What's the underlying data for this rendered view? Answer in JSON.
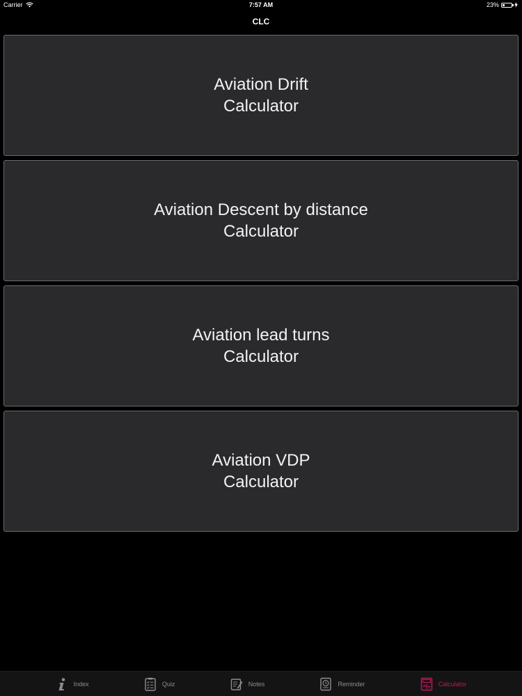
{
  "status_bar": {
    "carrier": "Carrier",
    "time": "7:57 AM",
    "battery_text": "23%",
    "battery_level": 0.23
  },
  "nav": {
    "title": "CLC"
  },
  "calculators": [
    {
      "line1": "Aviation Drift",
      "line2": "Calculator"
    },
    {
      "line1": "Aviation Descent by distance",
      "line2": "Calculator"
    },
    {
      "line1": "Aviation lead turns",
      "line2": "Calculator"
    },
    {
      "line1": "Aviation VDP",
      "line2": "Calculator"
    }
  ],
  "tabs": [
    {
      "label": "Index",
      "icon": "info-icon",
      "active": false
    },
    {
      "label": "Quiz",
      "icon": "quiz-icon",
      "active": false
    },
    {
      "label": "Notes",
      "icon": "notes-icon",
      "active": false
    },
    {
      "label": "Reminder",
      "icon": "reminder-icon",
      "active": false
    },
    {
      "label": "Calculator",
      "icon": "calculator-icon",
      "active": true
    }
  ],
  "colors": {
    "background": "#000000",
    "card": "#2a292c",
    "card_border": "#6b6a6e",
    "tab_inactive": "#8e8e93",
    "tab_active": "#c2185b"
  }
}
